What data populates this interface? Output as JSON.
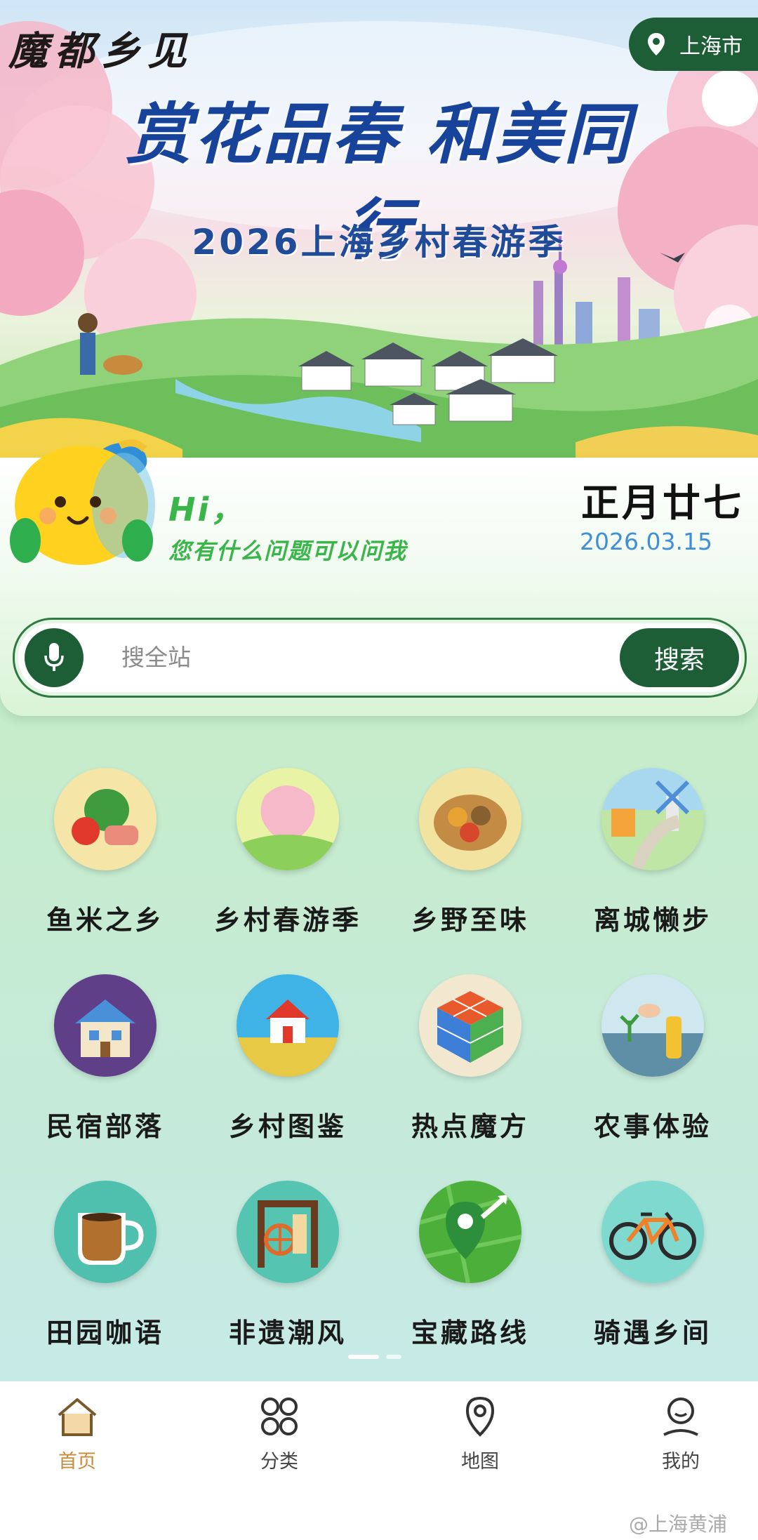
{
  "banner": {
    "brand": "魔都乡见",
    "location": "上海市",
    "headline": "赏花品春 和美同行",
    "subtitle": "2026上海乡村春游季"
  },
  "greeting": {
    "hi": "Hi，",
    "message": "您有什么问题可以问我",
    "lunar_date": "正月廿七",
    "date": "2026.03.15"
  },
  "search": {
    "placeholder": "搜全站",
    "button": "搜索"
  },
  "grid": [
    {
      "label": "鱼米之乡",
      "icon": "vegetables-icon"
    },
    {
      "label": "乡村春游季",
      "icon": "spring-landscape-icon"
    },
    {
      "label": "乡野至味",
      "icon": "food-basket-icon"
    },
    {
      "label": "离城懒步",
      "icon": "windmill-path-icon"
    },
    {
      "label": "民宿部落",
      "icon": "house-icon"
    },
    {
      "label": "乡村图鉴",
      "icon": "farmhouse-field-icon"
    },
    {
      "label": "热点魔方",
      "icon": "rubiks-cube-icon"
    },
    {
      "label": "农事体验",
      "icon": "planting-rice-icon"
    },
    {
      "label": "田园咖语",
      "icon": "coffee-cup-icon"
    },
    {
      "label": "非遗潮风",
      "icon": "loom-icon"
    },
    {
      "label": "宝藏路线",
      "icon": "map-pin-icon"
    },
    {
      "label": "骑遇乡间",
      "icon": "bicycle-icon"
    }
  ],
  "tabs": [
    {
      "label": "首页",
      "icon": "home-icon",
      "active": true
    },
    {
      "label": "分类",
      "icon": "grid-icon",
      "active": false
    },
    {
      "label": "地图",
      "icon": "map-location-icon",
      "active": false
    },
    {
      "label": "我的",
      "icon": "user-icon",
      "active": false
    }
  ],
  "watermark": "@上海黄浦",
  "colors": {
    "accent_green": "#1e5e37",
    "greeting_green": "#39b54a",
    "date_blue": "#3f8fd6",
    "active_tab": "#c98a3a"
  }
}
